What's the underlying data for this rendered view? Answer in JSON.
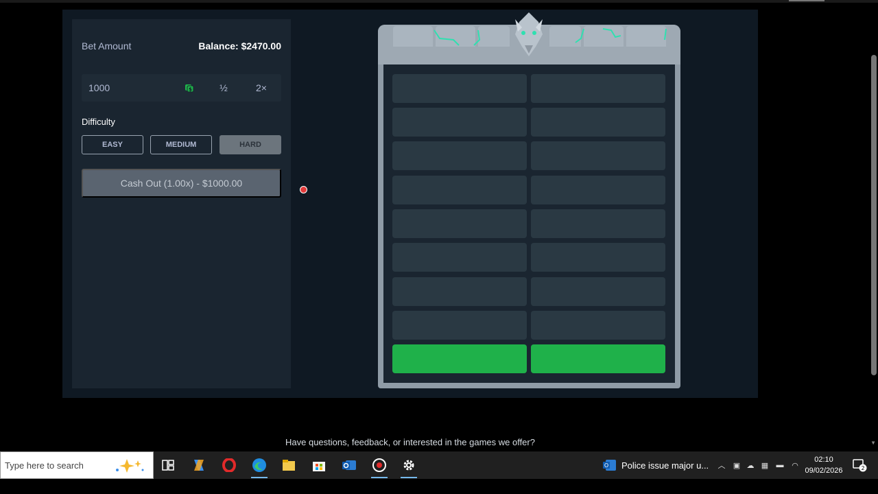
{
  "game": {
    "bet_label": "Bet Amount",
    "balance": "Balance: $2470.00",
    "bet_value": "1000",
    "half_label": "½",
    "double_label": "2×",
    "difficulty_label": "Difficulty",
    "difficulty_options": [
      "EASY",
      "MEDIUM",
      "HARD"
    ],
    "selected_difficulty": "HARD",
    "cashout_label": "Cash Out (1.00x) - $1000.00",
    "tower_rows": 9,
    "revealed_row_color": "#1fb14a",
    "tile_color": "#2a3943"
  },
  "footer": {
    "text": "Have questions, feedback, or interested in the games we offer?"
  },
  "taskbar": {
    "search_placeholder": "Type here to search",
    "apps": [
      "task-view-icon",
      "copilot-icon",
      "opera-icon",
      "edge-icon",
      "file-explorer-icon",
      "store-icon",
      "outlook-icon",
      "app-icon",
      "settings-icon"
    ],
    "news_text": "Police issue major u...",
    "time": "02:10",
    "date": "09/02/2026",
    "notification_count": "2"
  }
}
